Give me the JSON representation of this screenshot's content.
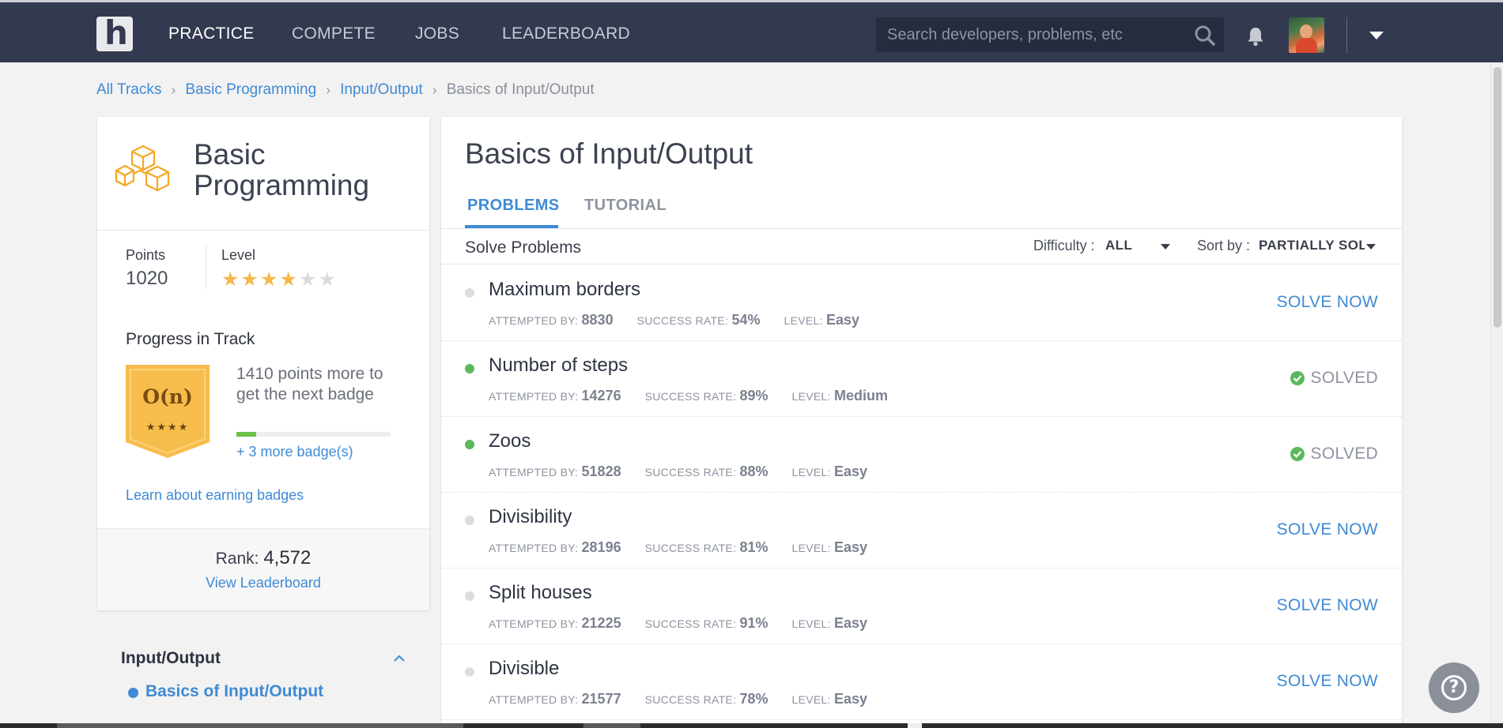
{
  "nav": {
    "logo_letter": "h",
    "links": [
      "PRACTICE",
      "COMPETE",
      "JOBS",
      "LEADERBOARD"
    ],
    "search_placeholder": "Search developers, problems, etc",
    "icons": [
      "search-icon",
      "bell-icon",
      "chevron-down-icon"
    ]
  },
  "breadcrumb": [
    "All Tracks",
    "Basic Programming",
    "Input/Output",
    "Basics of Input/Output"
  ],
  "track": {
    "title": "Basic Programming",
    "points_label": "Points",
    "points": "1020",
    "level_label": "Level",
    "level_stars": 4,
    "level_max": 6,
    "progress_title": "Progress in Track",
    "badge_label": "O(n)",
    "badge_stars": "★★★★",
    "progress_text": "1410 points more to get the next badge",
    "progress_fraction": 0.13,
    "more_badges": "+ 3 more badge(s)",
    "learn_link": "Learn about earning badges",
    "rank_label": "Rank:",
    "rank_value": "4,572",
    "view_leaderboard": "View Leaderboard",
    "accent_color": "#f5b84a"
  },
  "topics": {
    "title": "Input/Output",
    "items": [
      "Basics of Input/Output"
    ]
  },
  "main": {
    "title": "Basics of Input/Output",
    "tabs": [
      "PROBLEMS",
      "TUTORIAL"
    ],
    "active_tab": "PROBLEMS",
    "solve_problems": "Solve Problems",
    "difficulty_label": "Difficulty :",
    "difficulty_value": "ALL",
    "sort_label": "Sort by :",
    "sort_value": "PARTIALLY SOLVED",
    "meta_labels": {
      "attempted": "ATTEMPTED BY:",
      "success": "SUCCESS RATE:",
      "level": "LEVEL:"
    },
    "solve_now": "SOLVE NOW",
    "solved": "SOLVED",
    "problems": [
      {
        "title": "Maximum borders",
        "attempted": "8830",
        "success": "54%",
        "level": "Easy",
        "solved": false
      },
      {
        "title": "Number of steps",
        "attempted": "14276",
        "success": "89%",
        "level": "Medium",
        "solved": true
      },
      {
        "title": "Zoos",
        "attempted": "51828",
        "success": "88%",
        "level": "Easy",
        "solved": true
      },
      {
        "title": "Divisibility",
        "attempted": "28196",
        "success": "81%",
        "level": "Easy",
        "solved": false
      },
      {
        "title": "Split houses",
        "attempted": "21225",
        "success": "91%",
        "level": "Easy",
        "solved": false
      },
      {
        "title": "Divisible",
        "attempted": "21577",
        "success": "78%",
        "level": "Easy",
        "solved": false
      }
    ]
  },
  "help_label": "?",
  "colors": {
    "nav_bg": "#33394f",
    "link_blue": "#3f8ad4",
    "solved_green": "#5cb85c",
    "unsolved_dot": "#dcdde0",
    "badge_gold": "#f7bd4c"
  }
}
